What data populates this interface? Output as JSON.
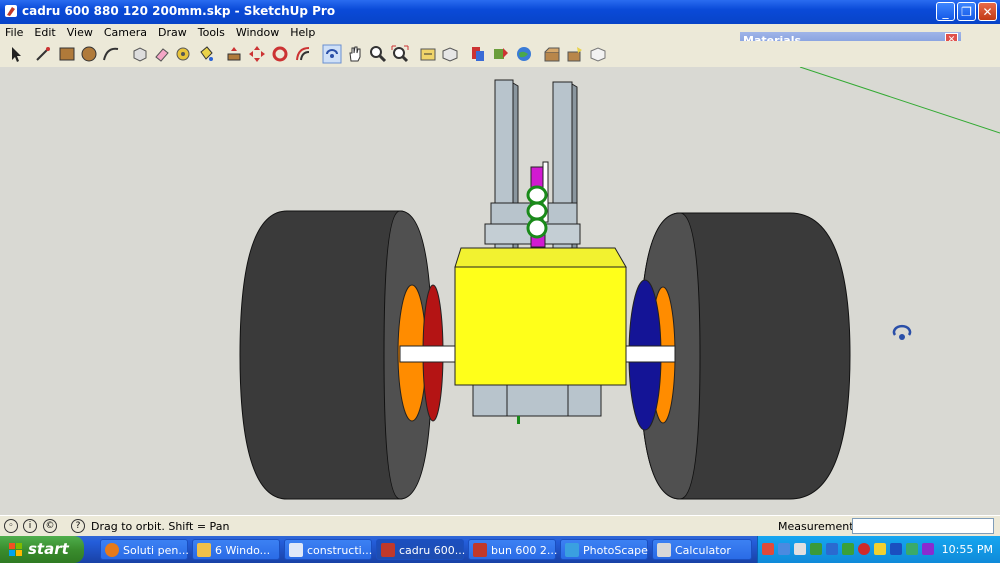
{
  "window": {
    "title": "cadru 600 880 120 200mm.skp - SketchUp Pro"
  },
  "menu": [
    "File",
    "Edit",
    "View",
    "Camera",
    "Draw",
    "Tools",
    "Window",
    "Help"
  ],
  "materials_panel": {
    "title": "Materials"
  },
  "status": {
    "hint": "Drag to orbit.  Shift = Pan",
    "measurements_label": "Measurements",
    "measurements_value": ""
  },
  "taskbar": {
    "start": "start",
    "tasks": [
      {
        "label": "Soluti pen..."
      },
      {
        "label": "6 Windo..."
      },
      {
        "label": "constructi..."
      },
      {
        "label": "cadru 600..."
      },
      {
        "label": "bun 600 2..."
      },
      {
        "label": "PhotoScape"
      },
      {
        "label": "Calculator"
      }
    ],
    "clock": "10:55 PM"
  },
  "colors": {
    "frame": "#b8c4cc",
    "box": "#ffff1a",
    "tire": "#3c3c3c",
    "hub_orange": "#ff8c00",
    "disc_red": "#b41414",
    "disc_blue": "#141496",
    "axle": "#ffffff",
    "shaft": "#d11ad1"
  }
}
